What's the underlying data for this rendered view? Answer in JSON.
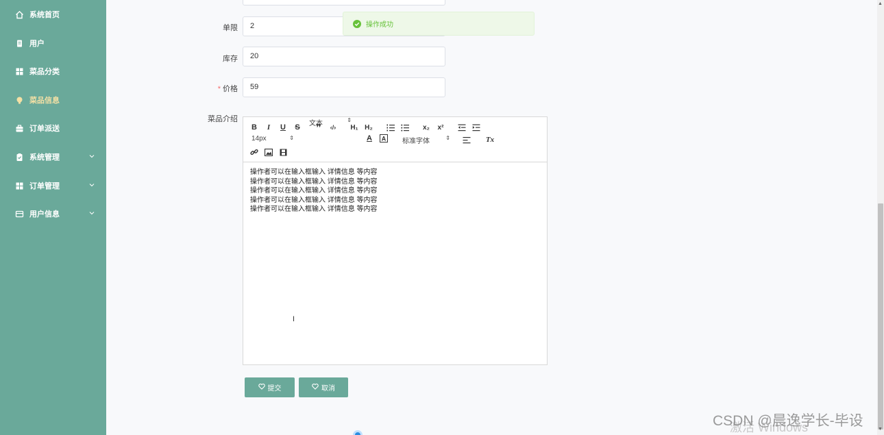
{
  "sidebar": {
    "items": [
      {
        "label": "系统首页",
        "icon": "home-icon"
      },
      {
        "label": "用户",
        "icon": "document-icon"
      },
      {
        "label": "菜品分类",
        "icon": "grid-icon"
      },
      {
        "label": "菜品信息",
        "icon": "lightbulb-icon",
        "active": true
      },
      {
        "label": "订单派送",
        "icon": "briefcase-icon"
      },
      {
        "label": "系统管理",
        "icon": "clipboard-icon",
        "has_children": true
      },
      {
        "label": "订单管理",
        "icon": "grid-icon",
        "has_children": true
      },
      {
        "label": "用户信息",
        "icon": "card-icon",
        "has_children": true
      }
    ],
    "active_color": "#f3e0a5",
    "bg_color": "#6aa99a"
  },
  "form": {
    "limit": {
      "label": "单限",
      "value": "2"
    },
    "stock": {
      "label": "库存",
      "value": "20"
    },
    "price": {
      "label": "价格",
      "value": "59",
      "required_mark": "*"
    },
    "intro": {
      "label": "菜品介绍"
    }
  },
  "editor": {
    "font_size": "14px",
    "block_type": "文本",
    "font_family": "标准字体",
    "lines": [
      "操作者可以在输入框输入  详情信息  等内容",
      "操作者可以在输入框输入  详情信息  等内容",
      "操作者可以在输入框输入  详情信息  等内容",
      "操作者可以在输入框输入  详情信息  等内容",
      "操作者可以在输入框输入  详情信息  等内容"
    ]
  },
  "buttons": {
    "submit": "提交",
    "cancel": "取消"
  },
  "toast": {
    "message": "操作成功",
    "color": "#67c23a"
  },
  "watermark": "CSDN @晨逸学长-毕设",
  "watermark_os": "激活 Windows"
}
